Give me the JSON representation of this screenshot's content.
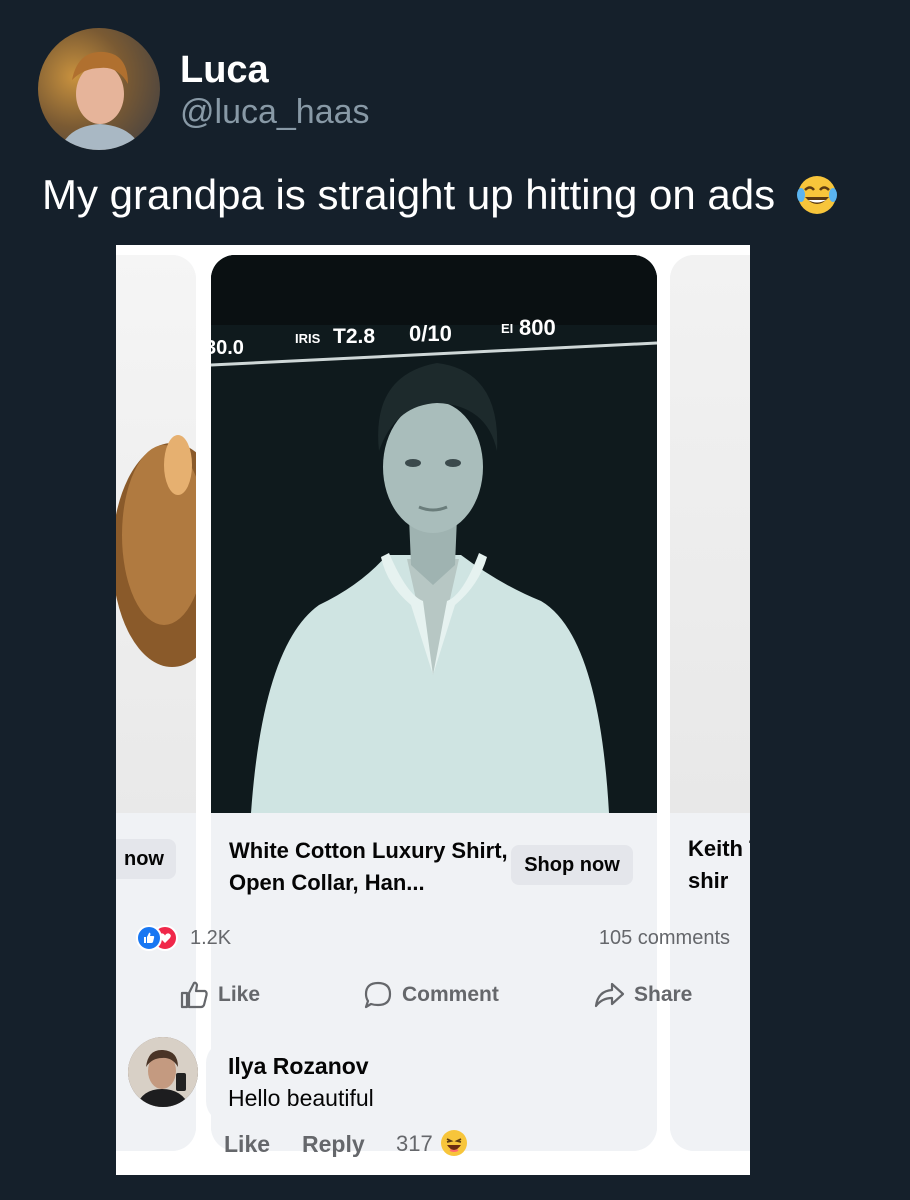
{
  "tweet": {
    "author_name": "Luca",
    "author_handle": "@luca_haas",
    "text": "My grandpa is straight up hitting on ads",
    "text_emoji": "face-with-tears-of-joy-icon"
  },
  "screenshot": {
    "carousel": {
      "left_card": {
        "button_label": "now"
      },
      "main_card": {
        "title": "White Cotton Luxury Shirt, Open Collar, Han...",
        "button_label": "Shop now",
        "image_overlay": {
          "left_value": "30.0",
          "iris_label": "IRIS",
          "iris_value": "T2.8",
          "fraction": "0/10",
          "ei_label": "EI",
          "ei_value": "800"
        }
      },
      "right_card": {
        "title": "Keith T-shir"
      }
    },
    "reactions": {
      "count": "1.2K",
      "comments": "105 comments",
      "icons": [
        "like-reaction-icon",
        "love-reaction-icon"
      ]
    },
    "actions": {
      "like": "Like",
      "comment": "Comment",
      "share": "Share"
    },
    "comment": {
      "author": "Ilya Rozanov",
      "text": "Hello beautiful",
      "like_label": "Like",
      "reply_label": "Reply",
      "reaction_count": "317",
      "reaction_emoji": "laughing-face-icon"
    }
  },
  "colors": {
    "background": "#15202b",
    "handle": "#8899a6",
    "fb_blue": "#1877f2",
    "fb_red": "#f0284a",
    "secondary_text": "#65676b",
    "button_gray": "#e4e6eb"
  }
}
